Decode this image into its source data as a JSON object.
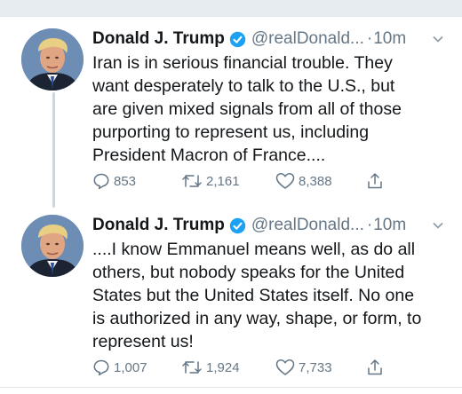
{
  "colors": {
    "text": "#14171a",
    "secondary": "#657786",
    "verified": "#1da1f2",
    "thread_line": "#ccd6dd"
  },
  "tweets": [
    {
      "name": "Donald J. Trump",
      "handle": "@realDonald...",
      "separator": "·",
      "time": "10m",
      "lines": [
        "Iran is in serious financial trouble. They",
        "want desperately to talk to the U.S., but",
        "are given mixed signals from all of those",
        "purporting to represent us, including",
        "President Macron of France...."
      ],
      "replies": "853",
      "retweets": "2,161",
      "likes": "8,388"
    },
    {
      "name": "Donald J. Trump",
      "handle": "@realDonald...",
      "separator": "·",
      "time": "10m",
      "lines": [
        "....I know Emmanuel means well, as do all",
        "others, but nobody speaks for the United",
        "States but the United States itself. No one",
        "is authorized in any way, shape, or form, to",
        "represent us!"
      ],
      "replies": "1,007",
      "retweets": "1,924",
      "likes": "7,733"
    }
  ]
}
